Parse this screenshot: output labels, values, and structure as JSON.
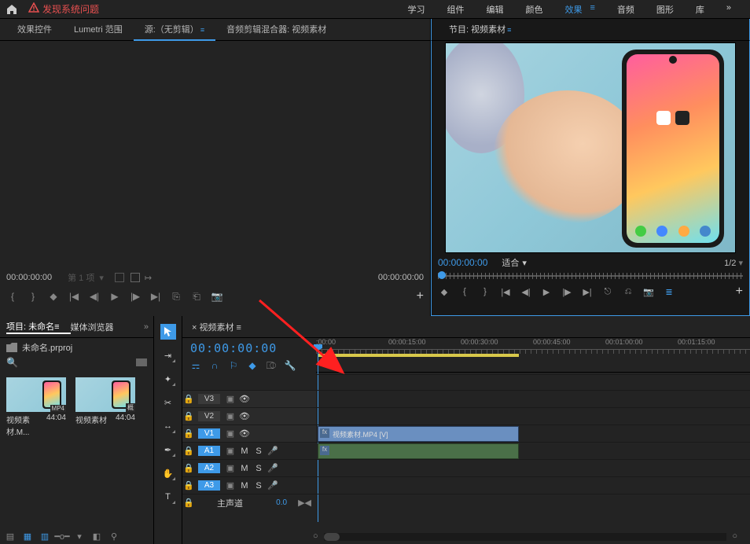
{
  "topbar": {
    "warning_text": "发现系统问题",
    "menu": [
      "学习",
      "组件",
      "编辑",
      "颜色",
      "效果",
      "音频",
      "图形",
      "库"
    ],
    "active_menu_index": 4
  },
  "source_tabs": {
    "items": [
      "效果控件",
      "Lumetri 范围",
      "源:（无剪辑）",
      "音频剪辑混合器: 视频素材"
    ],
    "active_index": 2
  },
  "source": {
    "tc_left": "00:00:00:00",
    "dropdown": "第 1 项",
    "tc_right": "00:00:00:00"
  },
  "program": {
    "tab_label": "节目: 视频素材",
    "tc": "00:00:00:00",
    "fit_label": "适合",
    "half": "1/2"
  },
  "project": {
    "tabs": [
      "项目: 未命名",
      "媒体浏览器"
    ],
    "active_tab_index": 0,
    "filename": "未命名.prproj",
    "thumbs": [
      {
        "name": "视频素材.M...",
        "duration": "44:04"
      },
      {
        "name": "视频素材",
        "duration": "44:04"
      }
    ]
  },
  "timeline": {
    "tab_label": "视频素材",
    "tc": "00:00:00:00",
    "ruler_labels": [
      {
        "text": ":00:00",
        "pos": 0
      },
      {
        "text": "00:00:15:00",
        "pos": 92
      },
      {
        "text": "00:00:30:00",
        "pos": 184
      },
      {
        "text": "00:00:45:00",
        "pos": 276
      },
      {
        "text": "00:01:00:00",
        "pos": 368
      },
      {
        "text": "00:01:15:00",
        "pos": 460
      }
    ],
    "tracks": {
      "video": [
        {
          "name": "V3",
          "selected": false
        },
        {
          "name": "V2",
          "selected": false
        },
        {
          "name": "V1",
          "selected": true
        }
      ],
      "audio": [
        {
          "name": "A1",
          "selected": true
        },
        {
          "name": "A2",
          "selected": true
        },
        {
          "name": "A3",
          "selected": true
        }
      ],
      "master_label": "主声道",
      "master_value": "0.0"
    },
    "clip_label": "视频素材.MP4 [V]"
  }
}
